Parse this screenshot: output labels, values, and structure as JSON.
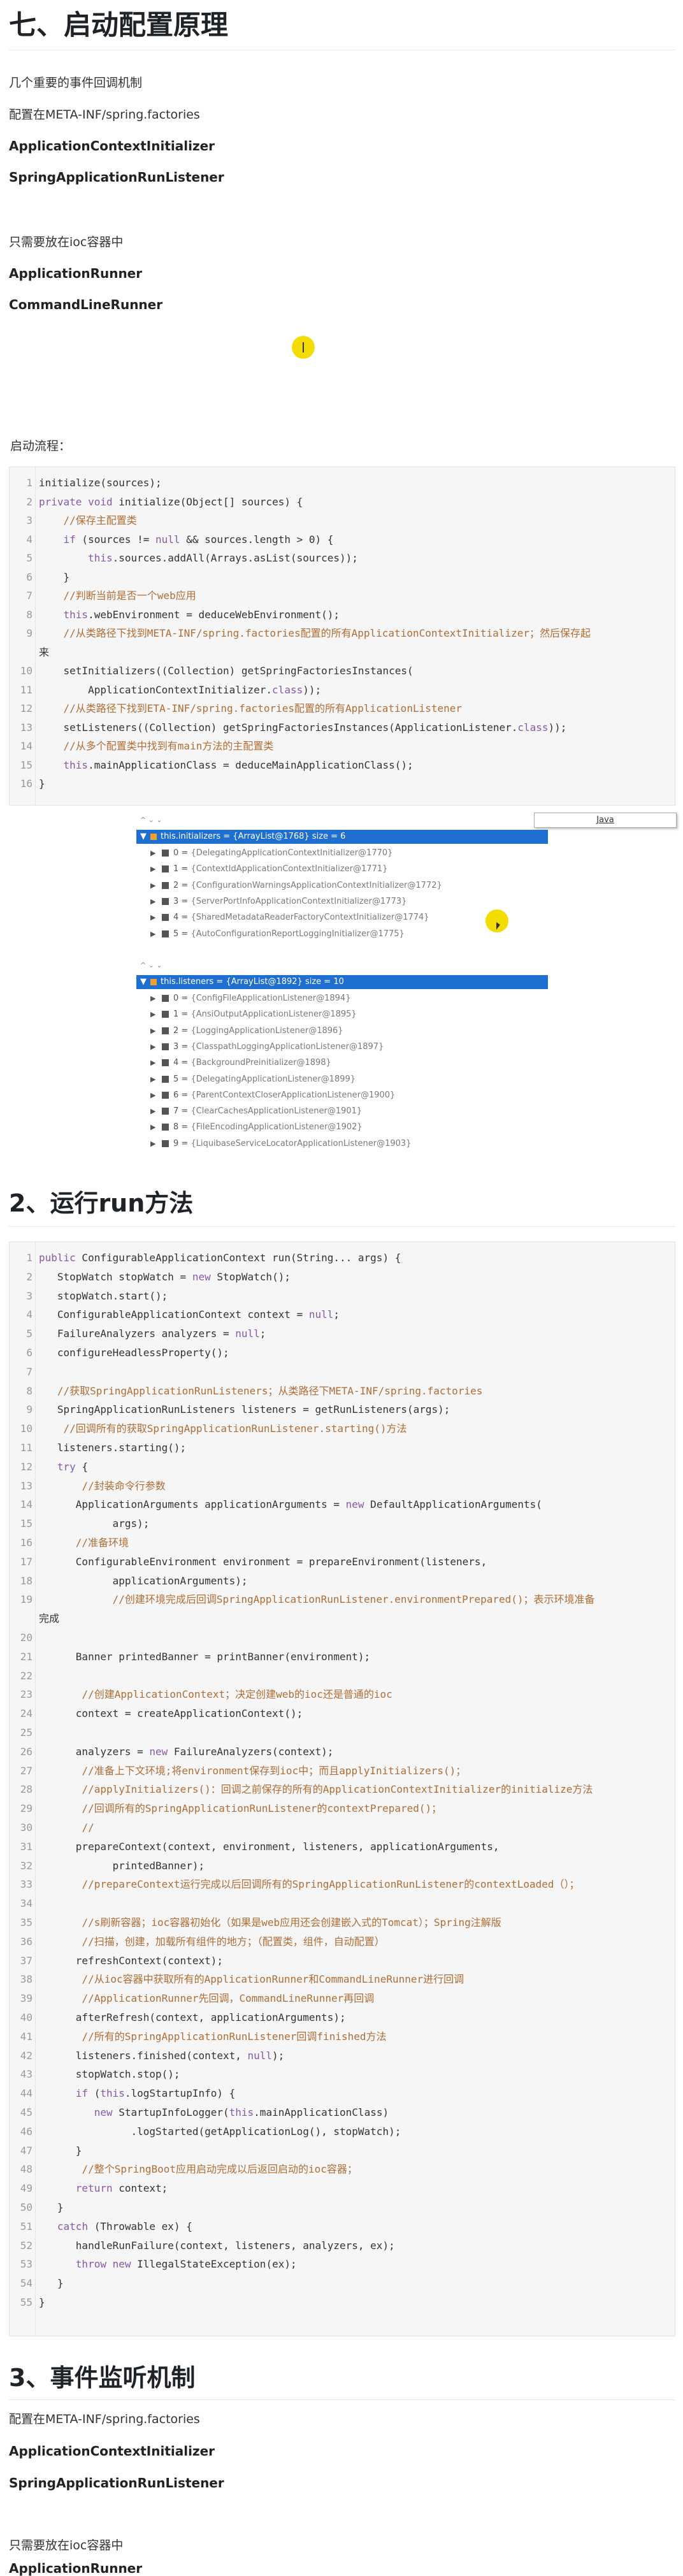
{
  "section7": {
    "title": "七、启动配置原理",
    "p1": "几个重要的事件回调机制",
    "p2": "配置在META-INF/spring.factories",
    "b1": "ApplicationContextInitializer",
    "b2": "SpringApplicationRunListener",
    "p3": "只需要放在ioc容器中",
    "b3": "ApplicationRunner",
    "b4": "CommandLineRunner",
    "p4": "启动流程：",
    "code": [
      {
        "n": "1",
        "t": "initialize(sources);"
      },
      {
        "n": "2",
        "t": "private void initialize(Object[] sources) {"
      },
      {
        "n": "3",
        "t": "    //保存主配置类"
      },
      {
        "n": "4",
        "t": "    if (sources != null && sources.length > 0) {"
      },
      {
        "n": "5",
        "t": "        this.sources.addAll(Arrays.asList(sources));"
      },
      {
        "n": "6",
        "t": "    }"
      },
      {
        "n": "7",
        "t": "    //判断当前是否一个web应用"
      },
      {
        "n": "8",
        "t": "    this.webEnvironment = deduceWebEnvironment();"
      },
      {
        "n": "9",
        "t": "    //从类路径下找到META-INF/spring.factories配置的所有ApplicationContextInitializer；然后保存起"
      },
      {
        "n": "",
        "t": "来"
      },
      {
        "n": "10",
        "t": "    setInitializers((Collection) getSpringFactoriesInstances("
      },
      {
        "n": "11",
        "t": "        ApplicationContextInitializer.class));"
      },
      {
        "n": "12",
        "t": "    //从类路径下找到ETA-INF/spring.factories配置的所有ApplicationListener"
      },
      {
        "n": "13",
        "t": "    setListeners((Collection) getSpringFactoriesInstances(ApplicationListener.class));"
      },
      {
        "n": "14",
        "t": "    //从多个配置类中找到有main方法的主配置类"
      },
      {
        "n": "15",
        "t": "    this.mainApplicationClass = deduceMainApplicationClass();"
      },
      {
        "n": "16",
        "t": "}"
      }
    ]
  },
  "debugger": {
    "tooltip": "Java",
    "toolbar1": "^  ⌄  ⌄",
    "initializers_head": "this.initializers = {ArrayList@1768}  size = 6",
    "initializers": [
      {
        "i": "0",
        "v": "{DelegatingApplicationContextInitializer@1770}"
      },
      {
        "i": "1",
        "v": "{ContextIdApplicationContextInitializer@1771}"
      },
      {
        "i": "2",
        "v": "{ConfigurationWarningsApplicationContextInitializer@1772}"
      },
      {
        "i": "3",
        "v": "{ServerPortInfoApplicationContextInitializer@1773}"
      },
      {
        "i": "4",
        "v": "{SharedMetadataReaderFactoryContextInitializer@1774}"
      },
      {
        "i": "5",
        "v": "{AutoConfigurationReportLoggingInitializer@1775}"
      }
    ],
    "toolbar2": "^  ⌄  ⌄",
    "listeners_head": "this.listeners = {ArrayList@1892}  size = 10",
    "listeners": [
      {
        "i": "0",
        "v": "{ConfigFileApplicationListener@1894}"
      },
      {
        "i": "1",
        "v": "{AnsiOutputApplicationListener@1895}"
      },
      {
        "i": "2",
        "v": "{LoggingApplicationListener@1896}"
      },
      {
        "i": "3",
        "v": "{ClasspathLoggingApplicationListener@1897}"
      },
      {
        "i": "4",
        "v": "{BackgroundPreinitializer@1898}"
      },
      {
        "i": "5",
        "v": "{DelegatingApplicationListener@1899}"
      },
      {
        "i": "6",
        "v": "{ParentContextCloserApplicationListener@1900}"
      },
      {
        "i": "7",
        "v": "{ClearCachesApplicationListener@1901}"
      },
      {
        "i": "8",
        "v": "{FileEncodingApplicationListener@1902}"
      },
      {
        "i": "9",
        "v": "{LiquibaseServiceLocatorApplicationListener@1903}"
      }
    ]
  },
  "section2": {
    "title": "2、运行run方法",
    "code": [
      {
        "n": "1",
        "t": "public ConfigurableApplicationContext run(String... args) {"
      },
      {
        "n": "2",
        "t": "   StopWatch stopWatch = new StopWatch();"
      },
      {
        "n": "3",
        "t": "   stopWatch.start();"
      },
      {
        "n": "4",
        "t": "   ConfigurableApplicationContext context = null;"
      },
      {
        "n": "5",
        "t": "   FailureAnalyzers analyzers = null;"
      },
      {
        "n": "6",
        "t": "   configureHeadlessProperty();"
      },
      {
        "n": "7",
        "t": ""
      },
      {
        "n": "8",
        "t": "   //获取SpringApplicationRunListeners；从类路径下META-INF/spring.factories"
      },
      {
        "n": "9",
        "t": "   SpringApplicationRunListeners listeners = getRunListeners(args);"
      },
      {
        "n": "10",
        "t": "    //回调所有的获取SpringApplicationRunListener.starting()方法"
      },
      {
        "n": "11",
        "t": "   listeners.starting();"
      },
      {
        "n": "12",
        "t": "   try {"
      },
      {
        "n": "13",
        "t": "       //封装命令行参数"
      },
      {
        "n": "14",
        "t": "      ApplicationArguments applicationArguments = new DefaultApplicationArguments("
      },
      {
        "n": "15",
        "t": "            args);"
      },
      {
        "n": "16",
        "t": "      //准备环境"
      },
      {
        "n": "17",
        "t": "      ConfigurableEnvironment environment = prepareEnvironment(listeners,"
      },
      {
        "n": "18",
        "t": "            applicationArguments);"
      },
      {
        "n": "19",
        "t": "            //创建环境完成后回调SpringApplicationRunListener.environmentPrepared()；表示环境准备"
      },
      {
        "n": "",
        "t": "完成"
      },
      {
        "n": "20",
        "t": ""
      },
      {
        "n": "21",
        "t": "      Banner printedBanner = printBanner(environment);"
      },
      {
        "n": "22",
        "t": ""
      },
      {
        "n": "23",
        "t": "       //创建ApplicationContext；决定创建web的ioc还是普通的ioc"
      },
      {
        "n": "24",
        "t": "      context = createApplicationContext();"
      },
      {
        "n": "25",
        "t": ""
      },
      {
        "n": "26",
        "t": "      analyzers = new FailureAnalyzers(context);"
      },
      {
        "n": "27",
        "t": "       //准备上下文环境;将environment保存到ioc中；而且applyInitializers()；"
      },
      {
        "n": "28",
        "t": "       //applyInitializers()：回调之前保存的所有的ApplicationContextInitializer的initialize方法"
      },
      {
        "n": "29",
        "t": "       //回调所有的SpringApplicationRunListener的contextPrepared()；"
      },
      {
        "n": "30",
        "t": "       //"
      },
      {
        "n": "31",
        "t": "      prepareContext(context, environment, listeners, applicationArguments,"
      },
      {
        "n": "32",
        "t": "            printedBanner);"
      },
      {
        "n": "33",
        "t": "       //prepareContext运行完成以后回调所有的SpringApplicationRunListener的contextLoaded（）；"
      },
      {
        "n": "34",
        "t": ""
      },
      {
        "n": "35",
        "t": "       //s刷新容器；ioc容器初始化（如果是web应用还会创建嵌入式的Tomcat）；Spring注解版"
      },
      {
        "n": "36",
        "t": "       //扫描，创建，加载所有组件的地方；（配置类，组件，自动配置）"
      },
      {
        "n": "37",
        "t": "      refreshContext(context);"
      },
      {
        "n": "38",
        "t": "       //从ioc容器中获取所有的ApplicationRunner和CommandLineRunner进行回调"
      },
      {
        "n": "39",
        "t": "       //ApplicationRunner先回调，CommandLineRunner再回调"
      },
      {
        "n": "40",
        "t": "      afterRefresh(context, applicationArguments);"
      },
      {
        "n": "41",
        "t": "       //所有的SpringApplicationRunListener回调finished方法"
      },
      {
        "n": "42",
        "t": "      listeners.finished(context, null);"
      },
      {
        "n": "43",
        "t": "      stopWatch.stop();"
      },
      {
        "n": "44",
        "t": "      if (this.logStartupInfo) {"
      },
      {
        "n": "45",
        "t": "         new StartupInfoLogger(this.mainApplicationClass)"
      },
      {
        "n": "46",
        "t": "               .logStarted(getApplicationLog(), stopWatch);"
      },
      {
        "n": "47",
        "t": "      }"
      },
      {
        "n": "48",
        "t": "       //整个SpringBoot应用启动完成以后返回启动的ioc容器；"
      },
      {
        "n": "49",
        "t": "      return context;"
      },
      {
        "n": "50",
        "t": "   }"
      },
      {
        "n": "51",
        "t": "   catch (Throwable ex) {"
      },
      {
        "n": "52",
        "t": "      handleRunFailure(context, listeners, analyzers, ex);"
      },
      {
        "n": "53",
        "t": "      throw new IllegalStateException(ex);"
      },
      {
        "n": "54",
        "t": "   }"
      },
      {
        "n": "55",
        "t": "}"
      }
    ]
  },
  "section3": {
    "title": "3、事件监听机制",
    "p1": "配置在META-INF/spring.factories",
    "b1": "ApplicationContextInitializer",
    "b2": "SpringApplicationRunListener",
    "p2": "只需要放在ioc容器中",
    "b3": "ApplicationRunner"
  },
  "colors": {
    "keyword": "#8959a8",
    "comment": "#b06d36",
    "debugger_selection": "#1f6fd1",
    "cursor_highlight": "#f5dc00"
  }
}
